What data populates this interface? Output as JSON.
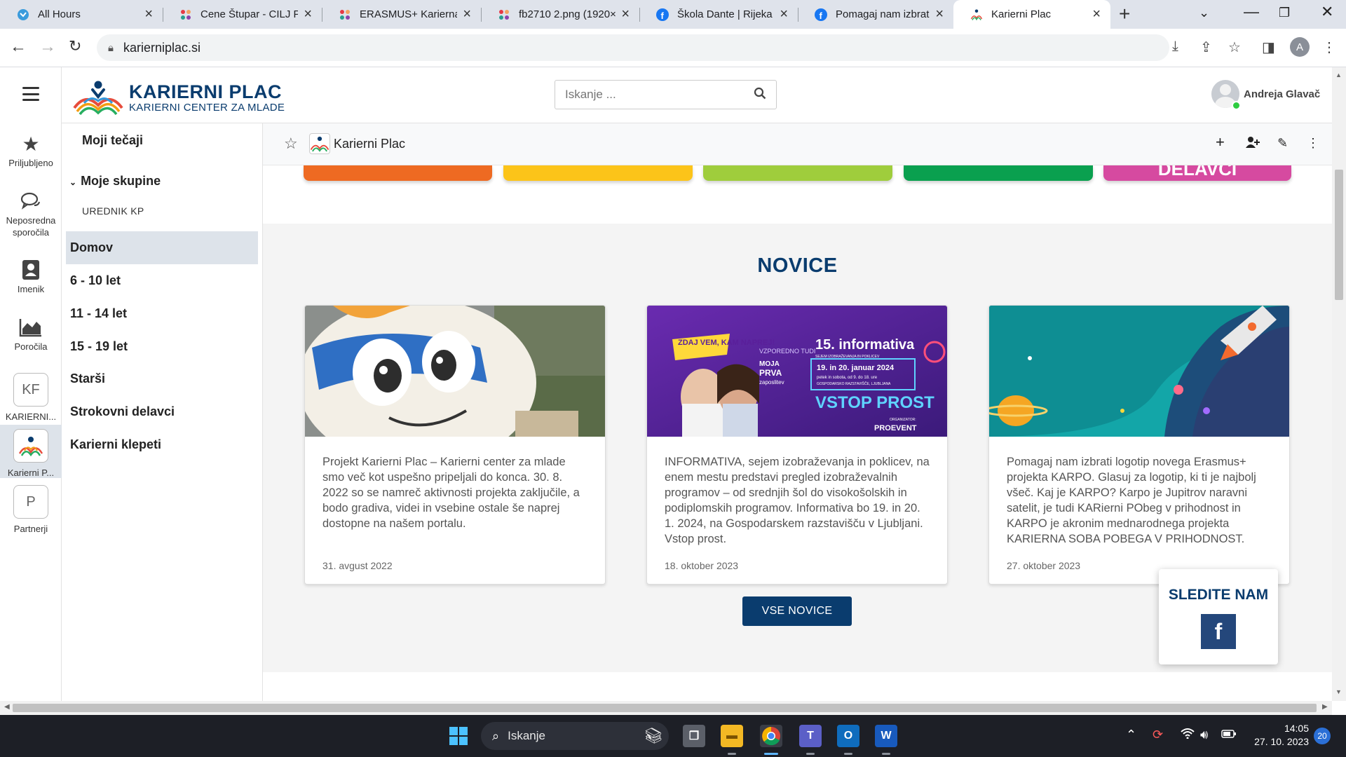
{
  "browser": {
    "tabs": [
      {
        "title": "All Hours",
        "icon": "all-hours-icon"
      },
      {
        "title": "Cene Štupar - CILJ Pe",
        "icon": "dots-logo-icon"
      },
      {
        "title": "ERASMUS+ Karierna",
        "icon": "dots-logo-icon"
      },
      {
        "title": "fb2710 2.png (1920×",
        "icon": "dots-logo-icon"
      },
      {
        "title": "Škola Dante | Rijeka |",
        "icon": "facebook-icon"
      },
      {
        "title": "Pomagaj nam izbrati",
        "icon": "facebook-icon"
      },
      {
        "title": "Karierni Plac",
        "icon": "karierni-plac-icon"
      }
    ],
    "url": "karierniplac.si",
    "profile_initial": "A"
  },
  "site": {
    "logo_title": "KARIERNI PLAC",
    "logo_subtitle": "KARIERNI CENTER ZA MLADE",
    "search_placeholder": "Iskanje ...",
    "user_name": "Andreja Glavač",
    "course_title": "Karierni Plac"
  },
  "rail": {
    "items": [
      {
        "label": "Priljubljeno",
        "icon": "star-icon"
      },
      {
        "label": "Neposredna sporočila",
        "icon": "chat-bubbles-icon"
      },
      {
        "label": "Imenik",
        "icon": "address-book-icon"
      },
      {
        "label": "Poročila",
        "icon": "area-chart-icon"
      },
      {
        "label": "KARIERNI...",
        "box": "KF"
      },
      {
        "label": "Karierni P...",
        "icon": "karierni-plac-icon"
      },
      {
        "label": "Partnerji",
        "box": "P"
      }
    ]
  },
  "leftnav": {
    "my_courses": "Moji tečaji",
    "my_groups": "Moje skupine",
    "group_item": "UREDNIK KP",
    "items": [
      "Domov",
      "6 - 10 let",
      "11 - 14 let",
      "15 - 19 let",
      "Starši",
      "Strokovni delavci",
      "Karierni klepeti"
    ]
  },
  "tiles": {
    "colors": [
      "#ee6a22",
      "#fcc419",
      "#9fcd3c",
      "#0aa04f",
      "#d64aa0"
    ],
    "last_label": "DELAVCI"
  },
  "news": {
    "title": "NOVICE",
    "cards": [
      {
        "text": "Projekt Karierni Plac – Karierni center za mlade smo več kot uspešno pripeljali do konca. 30. 8. 2022 so se namreč aktivnosti projekta zaključile, a bodo gradiva, videi in vsebine ostale še naprej dostopne na našem portalu.",
        "date": "31. avgust 2022"
      },
      {
        "text": "INFORMATIVA, sejem izobraževanja in poklicev, na enem mestu predstavi pregled izobraževalnih programov – od srednjih šol do visokošolskih in podiplomskih programov. Informativa bo 19. in 20. 1. 2024, na Gospodarskem razstavišču v Ljubljani. Vstop prost.",
        "date": "18. oktober 2023"
      },
      {
        "text": "Pomagaj nam izbrati logotip novega Erasmus+ projekta KARPO. Glasuj za logotip, ki ti je najbolj všeč. Kaj je KARPO? Karpo je Jupitrov naravni satelit, je tudi KARierni PObeg v prihodnost in KARPO je akronim mednarodnega projekta KARIERNA SOBA POBEGA V PRIHODNOST.",
        "date": "27. oktober 2023"
      }
    ],
    "banner": {
      "slogan": "ZDAJ VEM, KAM NAPREJ!",
      "event": "15. informativa",
      "tagline": "SEJEM IZOBRAŽEVANJA IN POKLICEV",
      "parallel": "VZPOREDNO TUDI",
      "moja": "MOJA",
      "prva": "PRVA",
      "zaposlitev": "zaposlitev",
      "dates": "19. in 20. januar 2024",
      "hours": "petek in sobota, od 9. do 18. ure",
      "venue": "GOSPODARSKO RAZSTAVIŠČE, LJUBLJANA",
      "free": "VSTOP PROST",
      "organizer_label": "ORGANIZATOR:",
      "organizer": "PROEVENT"
    },
    "all_button": "VSE NOVICE"
  },
  "follow": {
    "title": "SLEDITE NAM",
    "icon": "facebook-icon"
  },
  "taskbar": {
    "search": "Iskanje",
    "time": "14:05",
    "date": "27. 10. 2023",
    "notifications": "20"
  },
  "colors": {
    "brand_navy": "#0a3c6e",
    "facebook": "#24477b"
  }
}
